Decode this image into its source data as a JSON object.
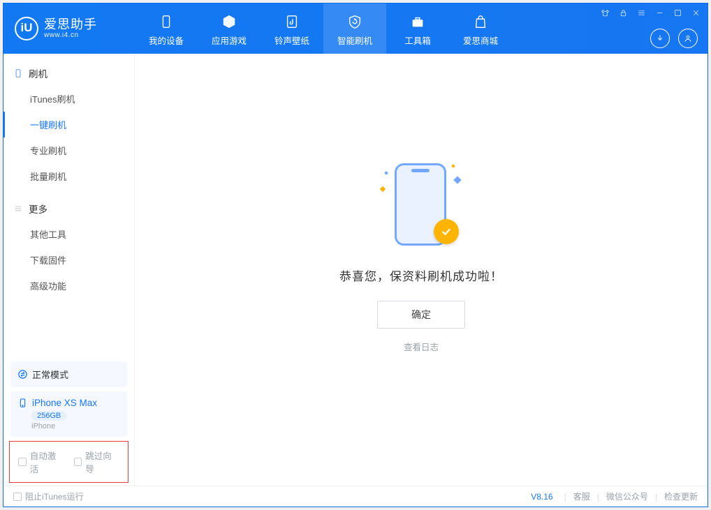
{
  "app": {
    "name": "爱思助手",
    "url": "www.i4.cn"
  },
  "nav": {
    "items": [
      {
        "label": "我的设备"
      },
      {
        "label": "应用游戏"
      },
      {
        "label": "铃声壁纸"
      },
      {
        "label": "智能刷机"
      },
      {
        "label": "工具箱"
      },
      {
        "label": "爱思商城"
      }
    ]
  },
  "sidebar": {
    "group_flash": "刷机",
    "group_more": "更多",
    "items_flash": [
      {
        "label": "iTunes刷机"
      },
      {
        "label": "一键刷机"
      },
      {
        "label": "专业刷机"
      },
      {
        "label": "批量刷机"
      }
    ],
    "items_more": [
      {
        "label": "其他工具"
      },
      {
        "label": "下载固件"
      },
      {
        "label": "高级功能"
      }
    ],
    "mode_label": "正常模式",
    "device": {
      "name": "iPhone XS Max",
      "capacity": "256GB",
      "type": "iPhone"
    },
    "auto_activate": "自动激活",
    "skip_guide": "跳过向导"
  },
  "main": {
    "success_text": "恭喜您，保资料刷机成功啦！",
    "confirm": "确定",
    "view_log": "查看日志"
  },
  "footer": {
    "block_itunes": "阻止iTunes运行",
    "version": "V8.16",
    "support": "客服",
    "wechat": "微信公众号",
    "check_update": "检查更新"
  }
}
